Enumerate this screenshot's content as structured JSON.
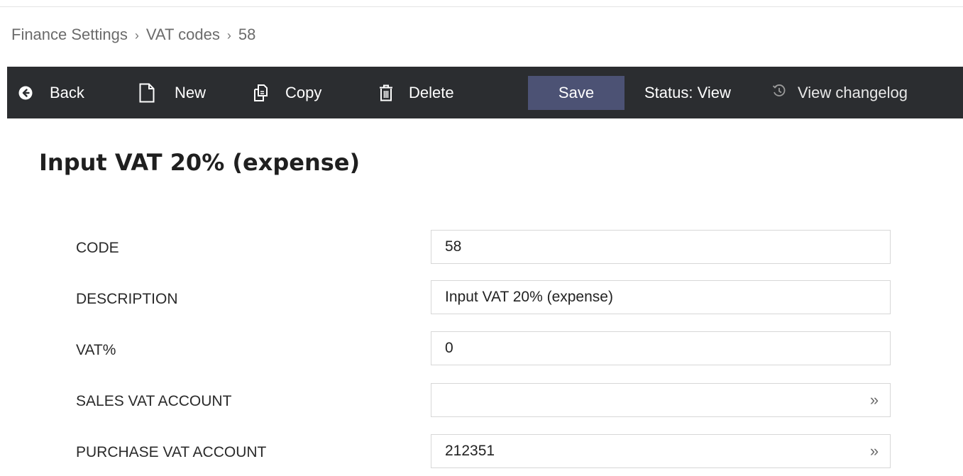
{
  "breadcrumb": {
    "items": [
      "Finance Settings",
      "VAT codes",
      "58"
    ],
    "separator": "›"
  },
  "toolbar": {
    "back_label": "Back",
    "new_label": "New",
    "copy_label": "Copy",
    "delete_label": "Delete",
    "save_label": "Save",
    "status_text": "Status: View",
    "changelog_label": "View changelog",
    "background": "#2b2d30",
    "save_color": "#4c5274"
  },
  "page": {
    "title": "Input VAT 20% (expense)"
  },
  "form": {
    "fields": [
      {
        "label": "CODE",
        "value": "58"
      },
      {
        "label": "DESCRIPTION",
        "value": "Input VAT 20% (expense)"
      },
      {
        "label": "VAT%",
        "value": "0"
      },
      {
        "label": "SALES VAT ACCOUNT",
        "value": "",
        "lookup": "»"
      },
      {
        "label": "PURCHASE VAT ACCOUNT",
        "value": "212351",
        "lookup": "»"
      }
    ]
  }
}
